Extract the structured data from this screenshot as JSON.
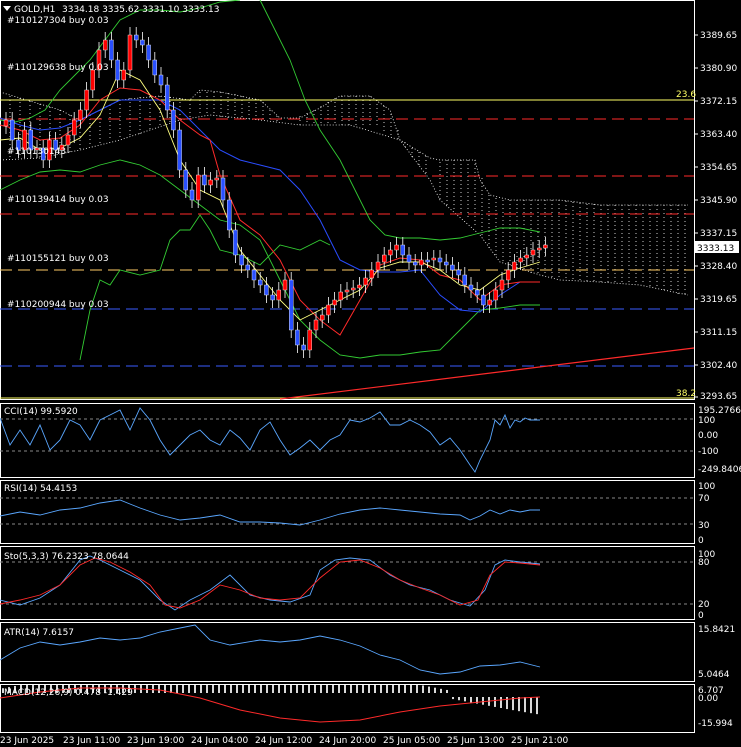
{
  "header": {
    "symbol": "GOLD,H1",
    "ohlc": "3334.18 3335.62 3331.10 3333.13"
  },
  "orders": [
    "#110127304 buy 0.03",
    "#110129638 buy 0.03",
    "#110130143",
    "#110139414 buy 0.03",
    "#110155121 buy 0.03",
    "#110200944 buy 0.03"
  ],
  "main_axis": [
    "3389.65",
    "3380.90",
    "3372.15",
    "3363.40",
    "3354.65",
    "3345.90",
    "3337.15",
    "3328.40",
    "3319.65",
    "3311.15",
    "3302.40",
    "3293.65"
  ],
  "current_price": "3333.13",
  "fib": {
    "top": "23.6",
    "bottom": "38.2"
  },
  "cci": {
    "label": "CCI(14) 99.5920",
    "axis": [
      "195.2766",
      "100",
      "0.00",
      "-100",
      "-249.8406"
    ]
  },
  "rsi": {
    "label": "RSI(14) 54.4153",
    "axis": [
      "100",
      "70",
      "30",
      "0"
    ]
  },
  "stoch": {
    "label": "Sto(5,3,3) 76.2323 78.0644",
    "axis": [
      "100",
      "80",
      "20",
      "0"
    ]
  },
  "atr": {
    "label": "ATR(14) 7.6157",
    "axis": [
      "15.8421",
      "5.0464"
    ]
  },
  "macd": {
    "label": "MACD(12,26,9) 0.478 -1.429",
    "axis": [
      "6.707",
      "0.00",
      "-15.994"
    ]
  },
  "time_axis": [
    "23 Jun 2025",
    "23 Jun 11:00",
    "23 Jun 19:00",
    "24 Jun 04:00",
    "24 Jun 12:00",
    "24 Jun 20:00",
    "25 Jun 05:00",
    "25 Jun 13:00",
    "25 Jun 21:00"
  ],
  "colors": {
    "bull": "#ff0000",
    "bear": "#2a50ff",
    "fib": "#ffff66",
    "indicator": "#5aa7ff"
  }
}
